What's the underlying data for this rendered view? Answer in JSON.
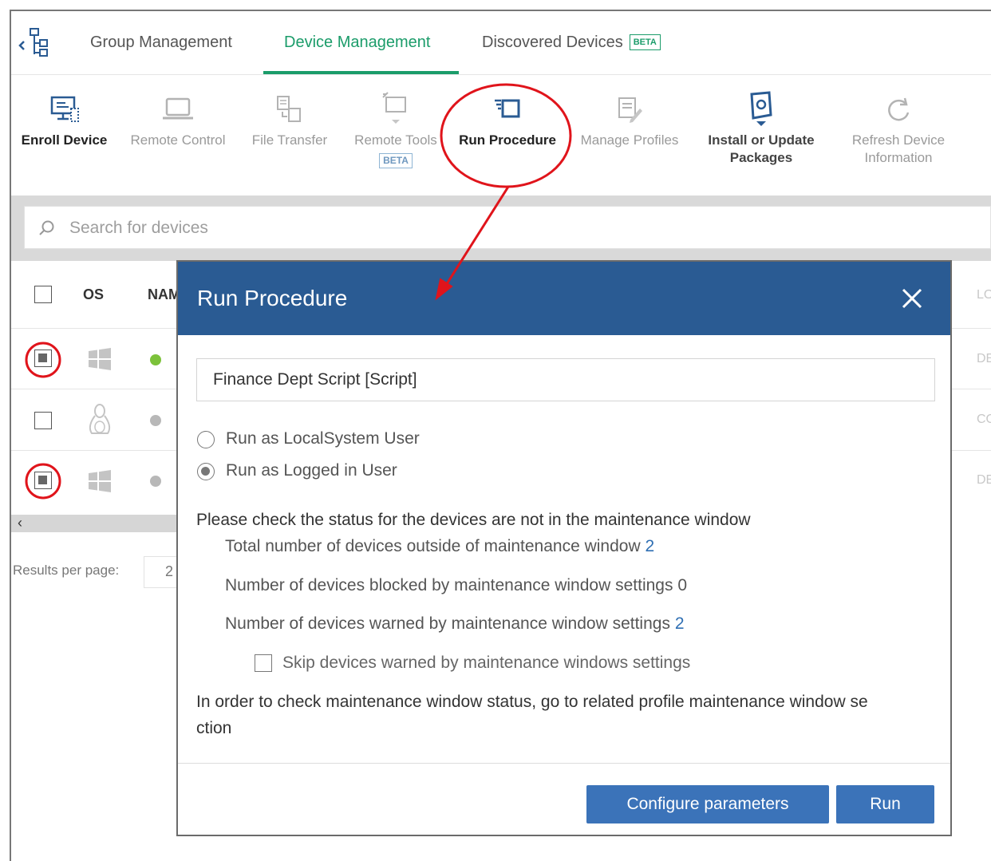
{
  "tabs": {
    "group": "Group Management",
    "device": "Device Management",
    "discovered": "Discovered Devices",
    "discovered_badge": "BETA"
  },
  "toolbar": {
    "enroll": "Enroll Device",
    "remote_control": "Remote Control",
    "file_transfer": "File Transfer",
    "remote_tools": "Remote Tools",
    "remote_tools_badge": "BETA",
    "run_procedure": "Run Procedure",
    "manage_profiles": "Manage Profiles",
    "install_line1": "Install or Update",
    "install_line2": "Packages",
    "refresh_line1": "Refresh Device",
    "refresh_line2": "Information"
  },
  "search": {
    "placeholder": "Search for devices"
  },
  "table": {
    "col_os": "OS",
    "col_name": "NAME",
    "col_right": "LO",
    "rows": [
      {
        "os": "windows",
        "status_color": "#7cc23a",
        "selected": true,
        "right": "DE"
      },
      {
        "os": "linux",
        "status_color": "#b8b8b8",
        "selected": false,
        "right": "CO"
      },
      {
        "os": "windows",
        "status_color": "#b8b8b8",
        "selected": true,
        "right": "DE"
      }
    ]
  },
  "pagination": {
    "results_label": "Results per page:",
    "per_page": "2"
  },
  "modal": {
    "title": "Run Procedure",
    "procedure": "Finance Dept Script [Script]",
    "radio_local": "Run as LocalSystem User",
    "radio_logged": "Run as Logged in User",
    "status_heading": "Please check the status for the devices are not in the maintenance window",
    "outside_label": "Total number of devices outside of maintenance window",
    "outside_value": "2",
    "blocked_label": "Number of devices blocked by maintenance window settings",
    "blocked_value": "0",
    "warned_label": "Number of devices warned by maintenance window settings",
    "warned_value": "2",
    "skip_label": "Skip devices warned by maintenance windows settings",
    "note_line1": "In order to check maintenance window status, go to related profile maintenance window se",
    "note_line2": "ction",
    "configure_button": "Configure parameters",
    "run_button": "Run"
  },
  "colors": {
    "accent_green": "#1b9c6a",
    "modal_header": "#2a5b93",
    "button_blue": "#3b73b9",
    "annotation_red": "#e0141b"
  }
}
